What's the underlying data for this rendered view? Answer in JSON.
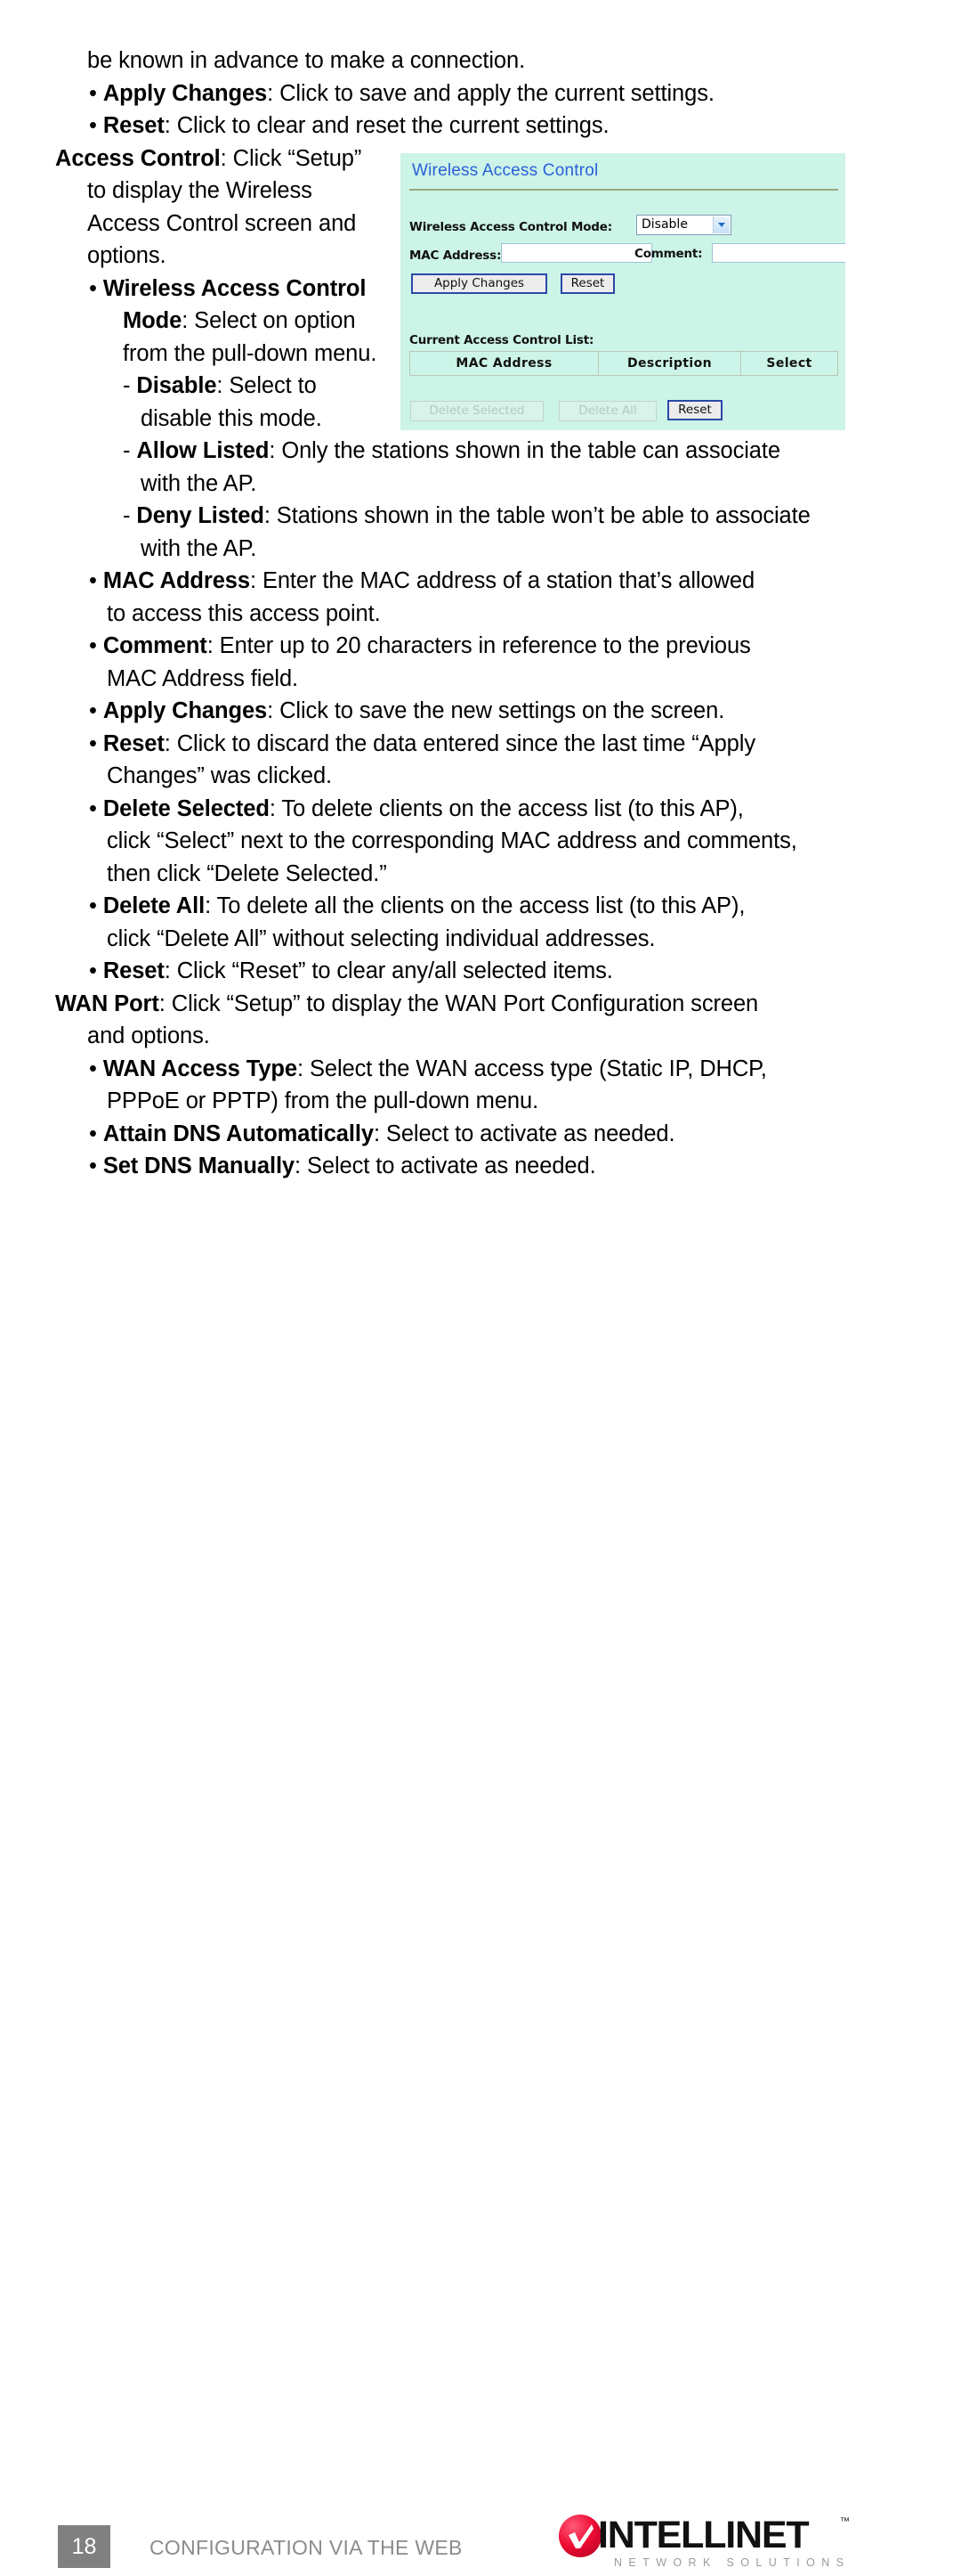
{
  "document": {
    "lines": [
      {
        "indent": "i1",
        "html": "be known in advance to make a connection."
      },
      {
        "indent": "i2",
        "html": "• <b>Apply Changes</b>: Click to save and apply the current settings."
      },
      {
        "indent": "i2",
        "html": "• <b>Reset</b>: Click to clear and reset the current settings."
      },
      {
        "indent": "i0",
        "html": "<b>Access Control</b>: Click “Setup”"
      },
      {
        "indent": "i1",
        "html": "to display the Wireless"
      },
      {
        "indent": "i1",
        "html": "Access Control screen and"
      },
      {
        "indent": "i1",
        "html": "options."
      },
      {
        "indent": "i2",
        "html": "• <b>Wireless Access Control</b>"
      },
      {
        "indent": "i4",
        "html": "<b>Mode</b>: Select on option"
      },
      {
        "indent": "i4",
        "html": "from the pull-down menu."
      },
      {
        "indent": "i4",
        "html": "- <b>Disable</b>: Select to"
      },
      {
        "indent": "i5",
        "html": "disable this mode."
      },
      {
        "indent": "i4",
        "html": "- <b>Allow Listed</b>: Only the stations shown in the table can associate"
      },
      {
        "indent": "i5",
        "html": "with the AP."
      },
      {
        "indent": "i4",
        "html": "- <b>Deny Listed</b>: Stations shown in the table won’t be able to associate"
      },
      {
        "indent": "i5",
        "html": "with the AP."
      },
      {
        "indent": "i2",
        "html": "• <b>MAC Address</b>: Enter the MAC address of a station that’s allowed"
      },
      {
        "indent": "i3",
        "html": "to access this access point."
      },
      {
        "indent": "i2",
        "html": "• <b>Comment</b>: Enter up to 20 characters in reference to the previous"
      },
      {
        "indent": "i3",
        "html": "MAC Address field."
      },
      {
        "indent": "i2",
        "html": "• <b>Apply Changes</b>: Click to save the new settings on the screen."
      },
      {
        "indent": "i2",
        "html": "• <b>Reset</b>: Click to discard the data entered since the last time “Apply"
      },
      {
        "indent": "i3",
        "html": "Changes” was clicked."
      },
      {
        "indent": "i2",
        "html": "• <b>Delete Selected</b>: To delete clients on the access list (to this AP),"
      },
      {
        "indent": "i3",
        "html": "click “Select” next to the corresponding MAC address and comments,"
      },
      {
        "indent": "i3",
        "html": "then click “Delete Selected.”"
      },
      {
        "indent": "i2",
        "html": "• <b>Delete All</b>: To delete all the clients on the access list (to this AP),"
      },
      {
        "indent": "i3",
        "html": "click “Delete All” without selecting individual addresses."
      },
      {
        "indent": "i2",
        "html": "• <b>Reset</b>: Click “Reset” to clear any/all selected items."
      },
      {
        "indent": "i0",
        "html": "<b>WAN Port</b>: Click “Setup” to display the WAN Port Configuration screen"
      },
      {
        "indent": "i1",
        "html": "and options."
      },
      {
        "indent": "i2",
        "html": "• <b>WAN Access Type</b>: Select the WAN access type (Static IP, DHCP,"
      },
      {
        "indent": "i3",
        "html": "PPPoE or PPTP) from the pull-down menu."
      },
      {
        "indent": "i2",
        "html": "• <b>Attain DNS Automatically</b>: Select to activate as needed."
      },
      {
        "indent": "i2",
        "html": "• <b>Set DNS Manually</b>: Select to activate as needed."
      }
    ]
  },
  "screenshot": {
    "title": "Wireless Access Control",
    "mode_label": "Wireless Access Control Mode:",
    "mode_value": "Disable",
    "mode_options": [
      "Disable",
      "Allow Listed",
      "Deny Listed"
    ],
    "mac_label": "MAC Address:",
    "mac_value": "",
    "comment_label": "Comment:",
    "comment_value": "",
    "apply_button": "Apply Changes",
    "reset_button": "Reset",
    "list_label": "Current Access Control List:",
    "table_headers": [
      "MAC Address",
      "Description",
      "Select"
    ],
    "delete_selected_button": "Delete Selected",
    "delete_all_button": "Delete All",
    "reset_button_2": "Reset",
    "colors": {
      "panel_background": "#ccf4e7",
      "title_text": "#2b5fd9",
      "rule": "#9aa77f"
    }
  },
  "footer": {
    "page_number": "18",
    "section_title": "CONFIGURATION VIA THE WEB",
    "brand_name": "INTELLINET",
    "brand_tagline": "NETWORK SOLUTIONS",
    "trademark": "™",
    "brand_color": "#ee0b33"
  }
}
